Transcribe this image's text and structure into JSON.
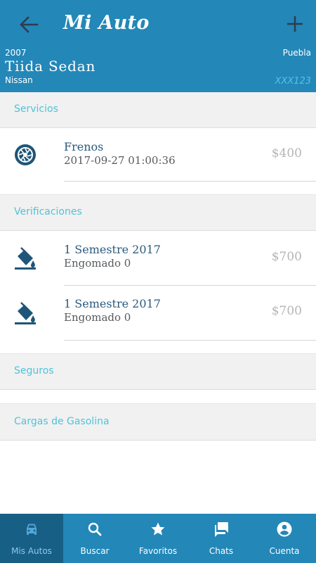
{
  "header": {
    "title": "Mi Auto",
    "back_icon": "arrow-left-icon",
    "add_icon": "plus-icon",
    "car": {
      "year": "2007",
      "model": "Tiida Sedan",
      "make": "Nissan",
      "city": "Puebla",
      "plate": "XXX123"
    }
  },
  "sections": {
    "servicios": {
      "title": "Servicios",
      "items": [
        {
          "title": "Frenos",
          "subtitle": "2017-09-27 01:00:36",
          "price": "$400",
          "icon": "brake-disc-icon"
        }
      ]
    },
    "verificaciones": {
      "title": "Verificaciones",
      "items": [
        {
          "title": "1 Semestre 2017",
          "subtitle": "Engomado 0",
          "price": "$700",
          "icon": "paint-bucket-icon"
        },
        {
          "title": "1 Semestre 2017",
          "subtitle": "Engomado 0",
          "price": "$700",
          "icon": "paint-bucket-icon"
        }
      ]
    },
    "seguros": {
      "title": "Seguros"
    },
    "gasolina": {
      "title": "Cargas de Gasolina"
    }
  },
  "bottom_nav": [
    {
      "label": "Mis Autos",
      "icon": "car-icon",
      "active": true
    },
    {
      "label": "Buscar",
      "icon": "search-icon",
      "active": false
    },
    {
      "label": "Favoritos",
      "icon": "star-icon",
      "active": false
    },
    {
      "label": "Chats",
      "icon": "chat-icon",
      "active": false
    },
    {
      "label": "Cuenta",
      "icon": "account-icon",
      "active": false
    }
  ],
  "colors": {
    "primary": "#2387b8",
    "primary_dark": "#185f86",
    "section_text": "#4fc3d8",
    "plate_text": "#4fc3ee",
    "item_title": "#2a5a7c",
    "price": "#b5b5b5"
  }
}
